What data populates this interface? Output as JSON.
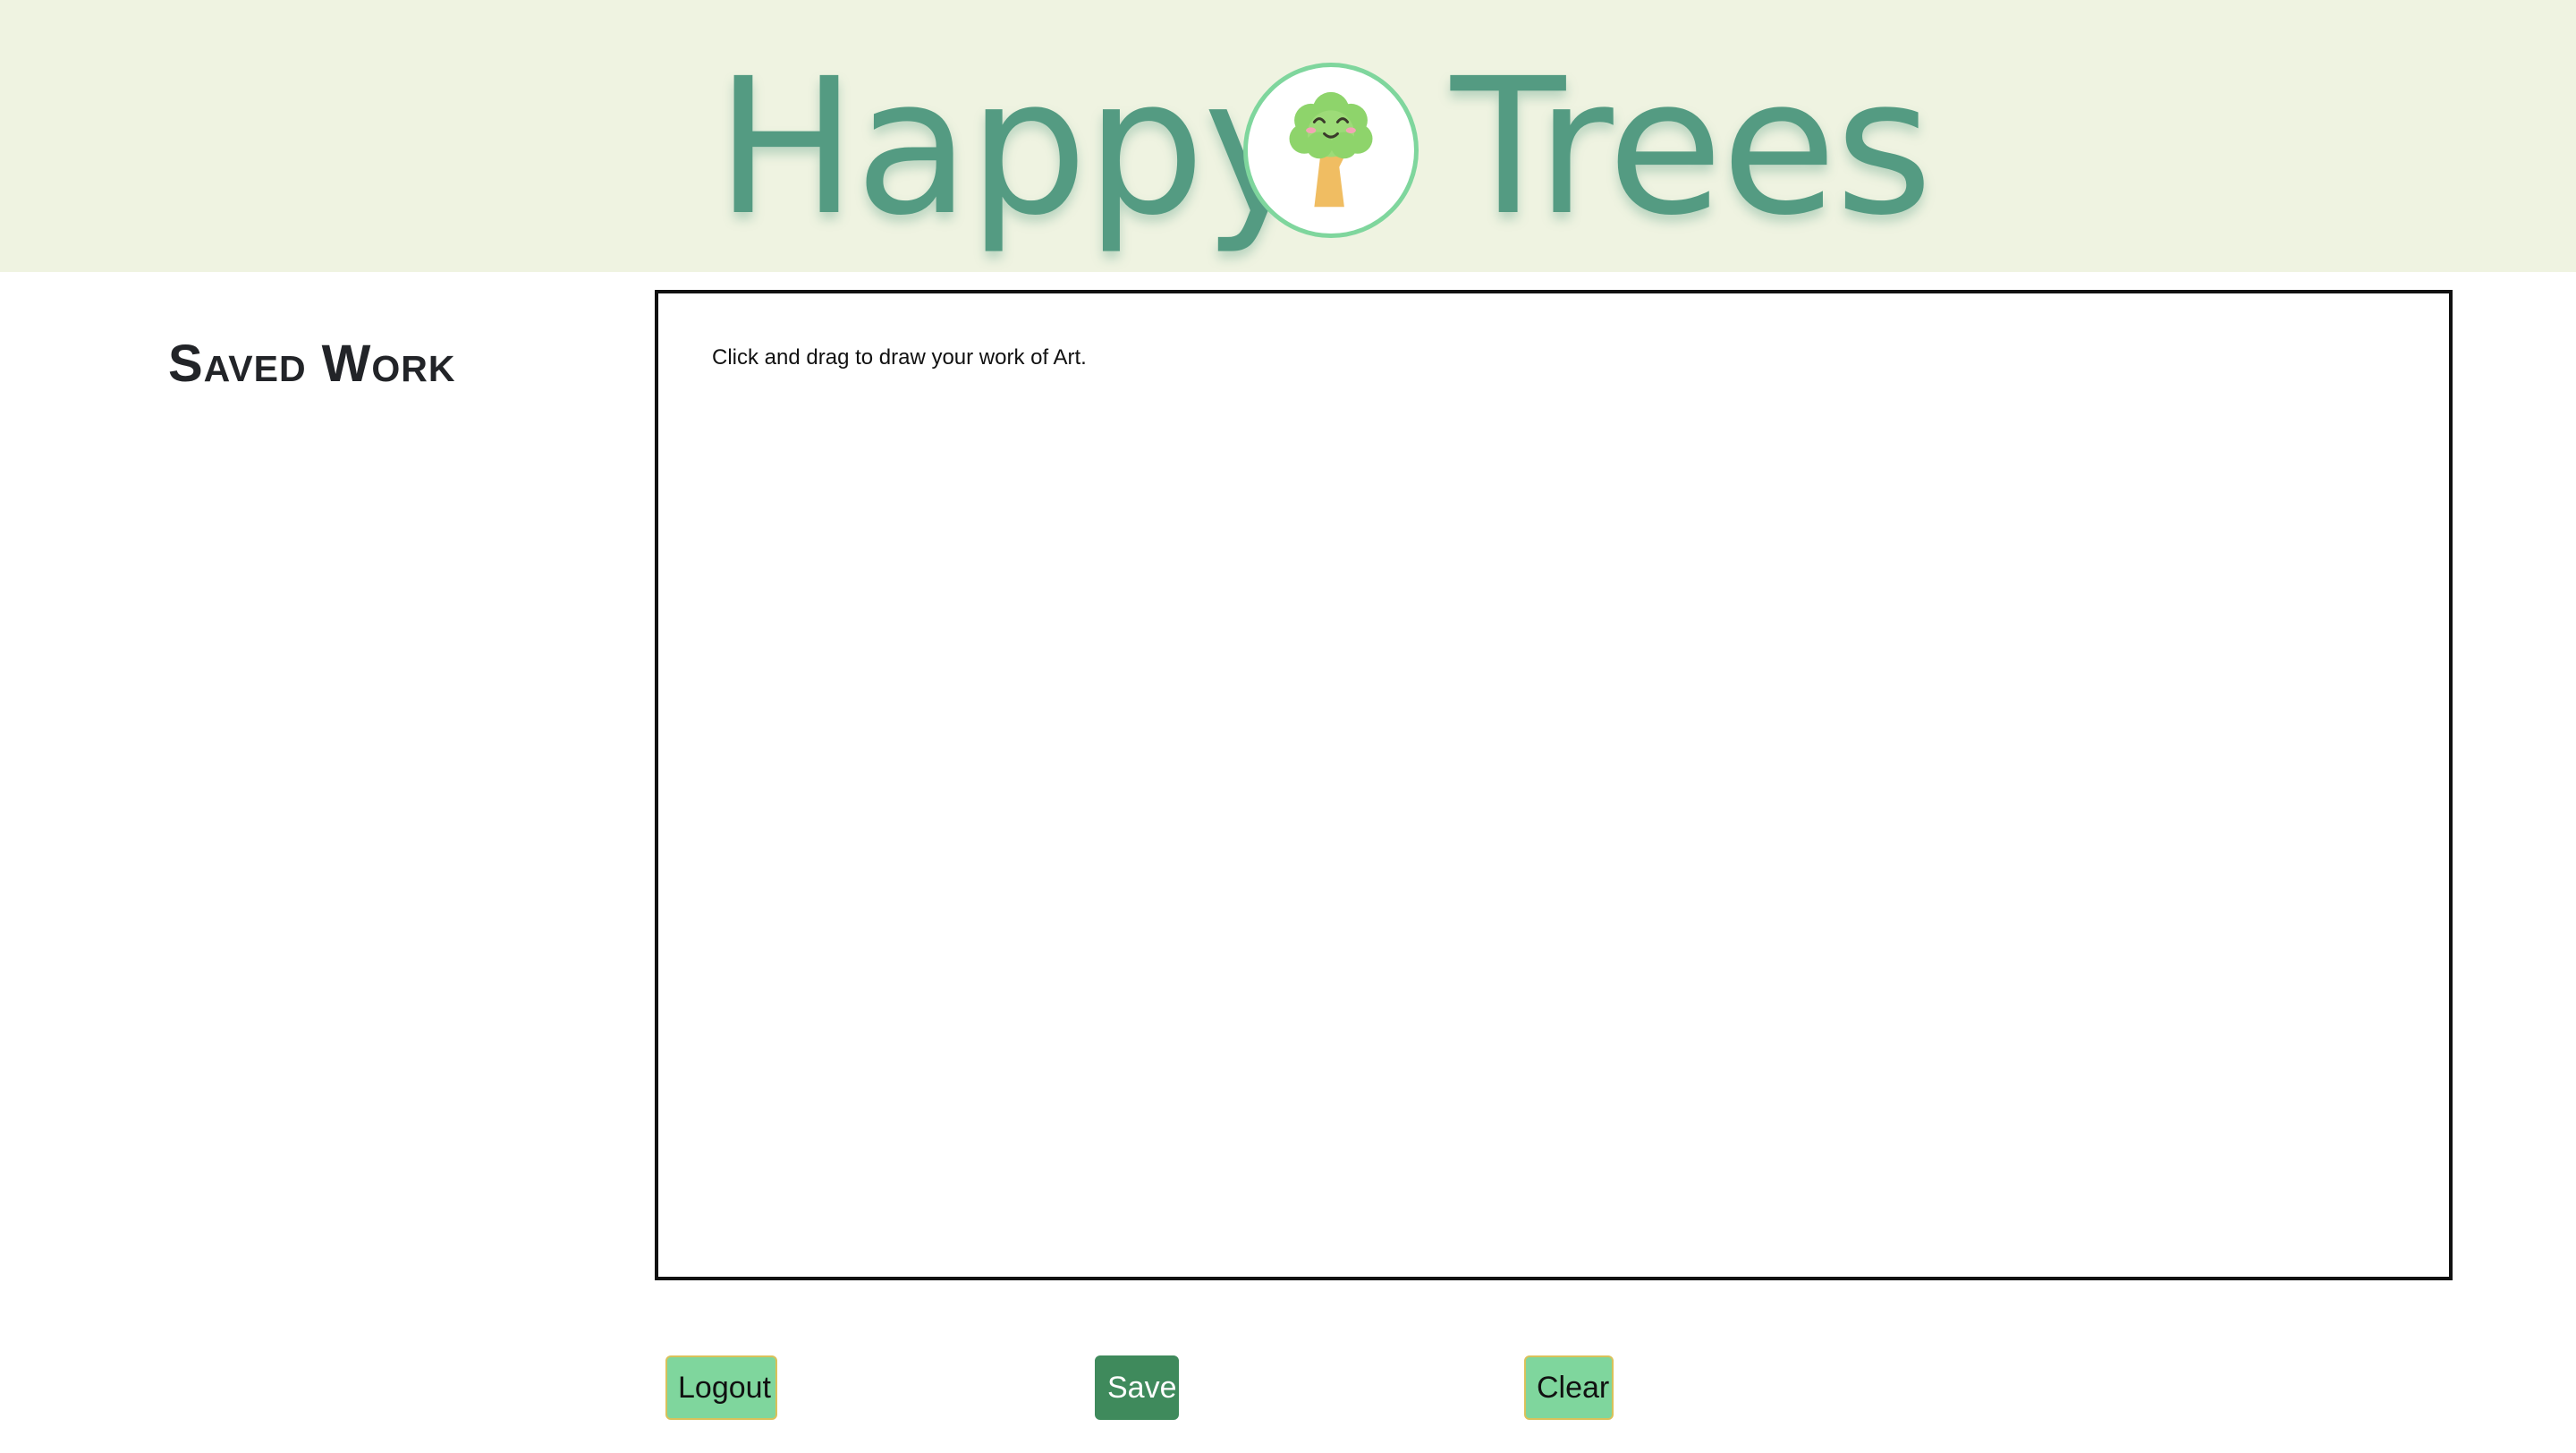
{
  "header": {
    "brand_left": "Happy",
    "brand_right": "Trees",
    "logo_icon": "smiling-tree-icon",
    "background_color": "#eff3e1",
    "brand_color": "#549b82"
  },
  "sidebar": {
    "title": "Saved Work"
  },
  "canvas": {
    "hint": "Click and drag to draw your work of Art."
  },
  "controls": {
    "logout_label": "Logout",
    "save_label": "Save",
    "clear_label": "Clear"
  },
  "colors": {
    "accent_light": "#7fd69d",
    "accent_dark": "#3f8a5c",
    "button_border": "#d9c15a"
  }
}
